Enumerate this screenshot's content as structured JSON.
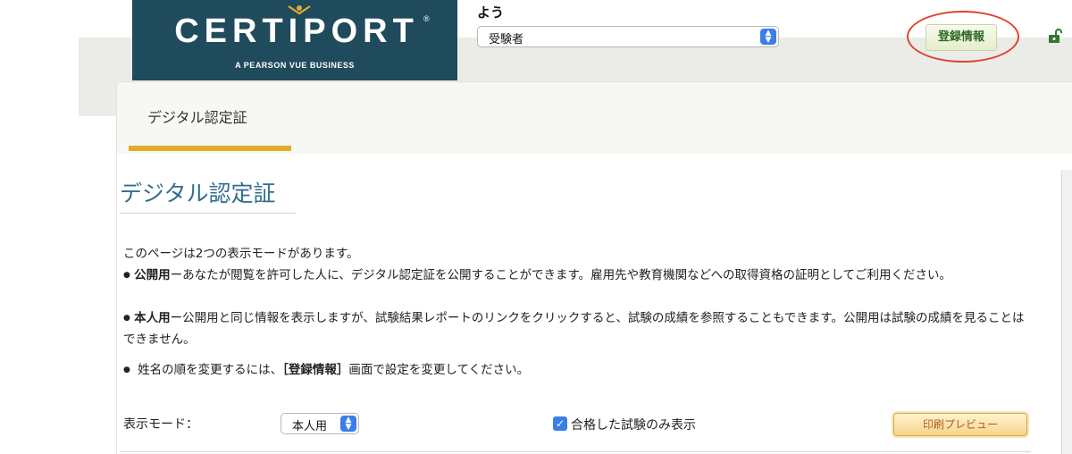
{
  "header": {
    "logo_text": "CERTIPORT",
    "logo_registered": "®",
    "logo_subtitle": "A PEARSON VUE BUSINESS",
    "welcome_text": "よう",
    "role_select_value": "受験者",
    "register_button": "登録情報",
    "lock_icon": "unlock-icon"
  },
  "tab": {
    "label": "デジタル認定証",
    "accent_color": "#e3ab2b"
  },
  "main": {
    "title": "デジタル認定証",
    "intro": "このページは2つの表示モードがあります。",
    "bullet1_bold": "公開用",
    "bullet1_text": "ーあなたが閲覧を許可した人に、デジタル認定証を公開することができます。雇用先や教育機関などへの取得資格の証明としてご利用ください。",
    "bullet2_bold": "本人用",
    "bullet2_text": "ー公開用と同じ情報を表示しますが、試験結果レポートのリンクをクリックすると、試験の成績を参照することもできます。公開用は試験の成績を見ることはできません。",
    "bullet3_pre": "姓名の順を変更するには、",
    "bullet3_bold": "［登録情報］",
    "bullet3_post": "画面で設定を変更してください。",
    "bullet_symbol": "●"
  },
  "controls": {
    "mode_label": "表示モード：",
    "mode_select_value": "本人用",
    "checkbox_label": "合格した試験のみ表示",
    "checkbox_checked": true,
    "print_button": "印刷プレビュー"
  },
  "colors": {
    "logo_bg": "#1f4b5c",
    "title_color": "#2f6f8e",
    "annotation_circle": "#e0442d"
  }
}
